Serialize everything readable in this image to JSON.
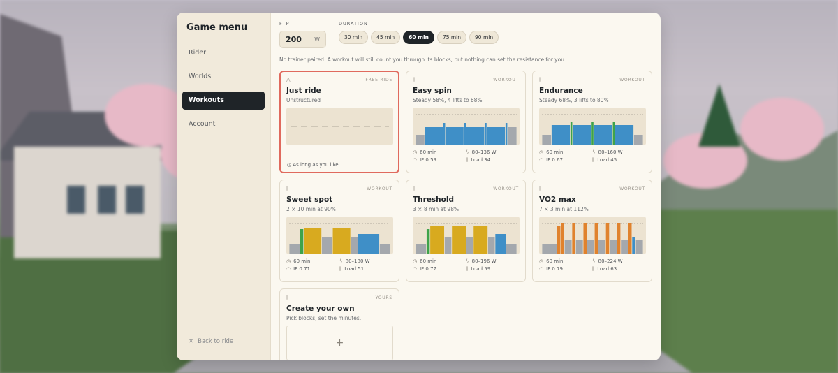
{
  "sidebar": {
    "title": "Game menu",
    "items": [
      {
        "label": "Rider",
        "active": false
      },
      {
        "label": "Worlds",
        "active": false
      },
      {
        "label": "Workouts",
        "active": true
      },
      {
        "label": "Account",
        "active": false
      }
    ],
    "back_label": "Back to ride",
    "back_icon": "close-icon"
  },
  "controls": {
    "ftp_label": "FTP",
    "ftp_value": "200",
    "ftp_unit": "W",
    "duration_label": "DURATION",
    "durations": [
      {
        "label": "30 min",
        "active": false
      },
      {
        "label": "45 min",
        "active": false
      },
      {
        "label": "60 min",
        "active": true
      },
      {
        "label": "75 min",
        "active": false
      },
      {
        "label": "90 min",
        "active": false
      }
    ]
  },
  "notice": "No trainer paired. A workout will still count you through its blocks, but nothing can set the resistance for you.",
  "colors": {
    "accent_selected": "#e06a5e",
    "green": "#3ea34a",
    "blue": "#3f8fc7",
    "yellow": "#d8aa1f",
    "orange": "#e0822d",
    "grey": "#a4a8ad"
  },
  "cards": [
    {
      "tag": "FREE RIDE",
      "title": "Just ride",
      "subtitle": "Unstructured",
      "selected": true,
      "footer": "As long as you like",
      "icon": "route-icon"
    },
    {
      "tag": "WORKOUT",
      "title": "Easy spin",
      "subtitle": "Steady 58%, 4 lifts to 68%",
      "selected": false,
      "icon": "bars-icon",
      "stats": {
        "duration": "60 min",
        "power": "80–136 W",
        "if": "IF 0.59",
        "load": "Load 34"
      },
      "blocks": [
        {
          "w": 4,
          "h": 30,
          "c": "grey"
        },
        {
          "w": 8,
          "h": 52,
          "c": "blue"
        },
        {
          "w": 1,
          "h": 64,
          "c": "blue"
        },
        {
          "w": 8,
          "h": 52,
          "c": "blue"
        },
        {
          "w": 1,
          "h": 64,
          "c": "blue"
        },
        {
          "w": 8,
          "h": 52,
          "c": "blue"
        },
        {
          "w": 1,
          "h": 64,
          "c": "blue"
        },
        {
          "w": 8,
          "h": 52,
          "c": "blue"
        },
        {
          "w": 1,
          "h": 64,
          "c": "blue"
        },
        {
          "w": 4,
          "h": 52,
          "c": "grey"
        }
      ]
    },
    {
      "tag": "WORKOUT",
      "title": "Endurance",
      "subtitle": "Steady 68%, 3 lifts to 80%",
      "selected": false,
      "icon": "bars-icon",
      "stats": {
        "duration": "60 min",
        "power": "80–160 W",
        "if": "IF 0.67",
        "load": "Load 45"
      },
      "blocks": [
        {
          "w": 4,
          "h": 30,
          "c": "grey"
        },
        {
          "w": 8,
          "h": 58,
          "c": "blue"
        },
        {
          "w": 1,
          "h": 68,
          "c": "green"
        },
        {
          "w": 8,
          "h": 58,
          "c": "blue"
        },
        {
          "w": 1,
          "h": 68,
          "c": "green"
        },
        {
          "w": 8,
          "h": 58,
          "c": "blue"
        },
        {
          "w": 1,
          "h": 68,
          "c": "green"
        },
        {
          "w": 8,
          "h": 58,
          "c": "blue"
        },
        {
          "w": 4,
          "h": 30,
          "c": "grey"
        }
      ]
    },
    {
      "tag": "WORKOUT",
      "title": "Sweet spot",
      "subtitle": "2 × 10 min at 90%",
      "selected": false,
      "icon": "bars-icon",
      "stats": {
        "duration": "60 min",
        "power": "80–180 W",
        "if": "IF 0.71",
        "load": "Load 51"
      },
      "blocks": [
        {
          "w": 3,
          "h": 30,
          "c": "grey"
        },
        {
          "w": 1,
          "h": 72,
          "c": "green"
        },
        {
          "w": 5,
          "h": 76,
          "c": "yellow"
        },
        {
          "w": 3,
          "h": 48,
          "c": "grey"
        },
        {
          "w": 5,
          "h": 76,
          "c": "yellow"
        },
        {
          "w": 2,
          "h": 48,
          "c": "grey"
        },
        {
          "w": 6,
          "h": 58,
          "c": "blue"
        },
        {
          "w": 3,
          "h": 30,
          "c": "grey"
        }
      ]
    },
    {
      "tag": "WORKOUT",
      "title": "Threshold",
      "subtitle": "3 × 8 min at 98%",
      "selected": false,
      "icon": "bars-icon",
      "stats": {
        "duration": "60 min",
        "power": "80–196 W",
        "if": "IF 0.77",
        "load": "Load 59"
      },
      "blocks": [
        {
          "w": 3,
          "h": 30,
          "c": "grey"
        },
        {
          "w": 1,
          "h": 72,
          "c": "green"
        },
        {
          "w": 4,
          "h": 82,
          "c": "yellow"
        },
        {
          "w": 2,
          "h": 48,
          "c": "grey"
        },
        {
          "w": 4,
          "h": 82,
          "c": "yellow"
        },
        {
          "w": 2,
          "h": 48,
          "c": "grey"
        },
        {
          "w": 4,
          "h": 82,
          "c": "yellow"
        },
        {
          "w": 2,
          "h": 48,
          "c": "grey"
        },
        {
          "w": 3,
          "h": 58,
          "c": "blue"
        },
        {
          "w": 3,
          "h": 30,
          "c": "grey"
        }
      ]
    },
    {
      "tag": "WORKOUT",
      "title": "VO2 max",
      "subtitle": "7 × 3 min at 112%",
      "selected": false,
      "icon": "bars-icon",
      "stats": {
        "duration": "60 min",
        "power": "80–224 W",
        "if": "IF 0.79",
        "load": "Load 63"
      },
      "blocks": [
        {
          "w": 4,
          "h": 30,
          "c": "grey"
        },
        {
          "w": 1,
          "h": 82,
          "c": "orange"
        },
        {
          "w": 1,
          "h": 90,
          "c": "orange"
        },
        {
          "w": 2,
          "h": 40,
          "c": "grey"
        },
        {
          "w": 1,
          "h": 90,
          "c": "orange"
        },
        {
          "w": 2,
          "h": 40,
          "c": "grey"
        },
        {
          "w": 1,
          "h": 90,
          "c": "orange"
        },
        {
          "w": 2,
          "h": 40,
          "c": "grey"
        },
        {
          "w": 1,
          "h": 90,
          "c": "orange"
        },
        {
          "w": 2,
          "h": 40,
          "c": "grey"
        },
        {
          "w": 1,
          "h": 90,
          "c": "orange"
        },
        {
          "w": 2,
          "h": 40,
          "c": "grey"
        },
        {
          "w": 1,
          "h": 90,
          "c": "orange"
        },
        {
          "w": 2,
          "h": 40,
          "c": "grey"
        },
        {
          "w": 1,
          "h": 90,
          "c": "orange"
        },
        {
          "w": 1,
          "h": 48,
          "c": "blue"
        },
        {
          "w": 2,
          "h": 40,
          "c": "grey"
        }
      ]
    }
  ],
  "create_card": {
    "tag": "YOURS",
    "title": "Create your own",
    "subtitle": "Pick blocks, set the minutes.",
    "icon": "bars-icon",
    "action_icon": "plus-icon"
  }
}
